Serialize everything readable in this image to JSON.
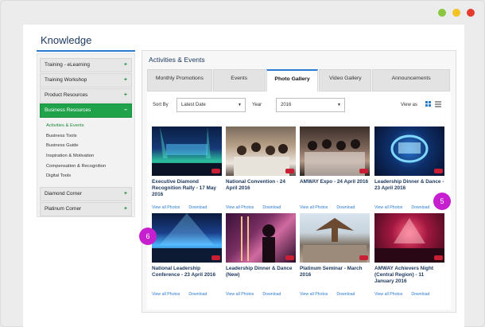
{
  "window_controls": [
    "minimize",
    "maximize",
    "close"
  ],
  "page": {
    "title": "Knowledge"
  },
  "sidebar": {
    "items": [
      {
        "label": "Training - eLearning",
        "toggle": "+"
      },
      {
        "label": "Training Workshop",
        "toggle": "+"
      },
      {
        "label": "Product Resources",
        "toggle": "+"
      },
      {
        "label": "Business Resources",
        "toggle": "–",
        "active": true
      }
    ],
    "sub_items": [
      "Activities & Events",
      "Business Tools",
      "Business Guide",
      "Inspiration & Motivation",
      "Compensation & Recognition",
      "Digital Tools"
    ],
    "bottom_items": [
      {
        "label": "Diamond Corner",
        "toggle": "+"
      },
      {
        "label": "Platinum Corner",
        "toggle": "+"
      }
    ]
  },
  "main": {
    "title": "Activities & Events",
    "tabs": [
      "Monthly Promotions",
      "Events",
      "Photo Gallery",
      "Video Gallery",
      "Announcements"
    ],
    "active_tab": "Photo Gallery",
    "filters": {
      "sort_label": "Sort By",
      "sort_value": "Latest Date",
      "year_label": "Year",
      "year_value": "2016",
      "view_as_label": "View as"
    },
    "cards": [
      {
        "title": "Executive Diamond Recognition Rally - 17 May 2016",
        "link1": "View all Photos",
        "link2": "Download"
      },
      {
        "title": "National Convention - 24 April 2016",
        "link1": "View all Photos",
        "link2": "Download"
      },
      {
        "title": "AMWAY Expo - 24 April 2016",
        "link1": "View all Photos",
        "link2": "Download"
      },
      {
        "title": "Leadership Dinner & Dance - 23 April 2016",
        "link1": "View all Photos",
        "link2": "Download"
      },
      {
        "title": "National Leadership Conference - 23 April 2016",
        "link1": "View all Photos",
        "link2": "Download"
      },
      {
        "title": "Leadership Dinner & Dance (New)",
        "link1": "View all Photos",
        "link2": "Download"
      },
      {
        "title": "Platinum Seminar - March 2016",
        "link1": "View all Photos",
        "link2": "Download"
      },
      {
        "title": "AMWAY Achievers Night (Central Region) - 11 January 2016",
        "link1": "View all Photos",
        "link2": "Download"
      }
    ]
  },
  "markers": [
    "5",
    "6"
  ],
  "colors": {
    "accent_blue": "#2b7bd0",
    "active_green": "#1fa24a",
    "marker_magenta": "#c51fcf",
    "title_navy": "#1f3a60"
  }
}
